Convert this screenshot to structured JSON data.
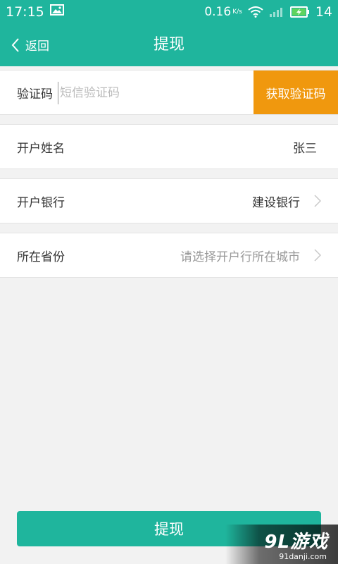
{
  "status_bar": {
    "time": "17:15",
    "net_speed": "0.16",
    "net_speed_unit": "K/s",
    "battery_level": "14",
    "icons": [
      "image-icon",
      "wifi-icon",
      "signal-icon",
      "battery-charging-icon"
    ]
  },
  "header": {
    "back_label": "返回",
    "title": "提现"
  },
  "form": {
    "verification": {
      "label": "验证码",
      "placeholder": "短信验证码",
      "value": "",
      "button_label": "获取验证码"
    },
    "account_name": {
      "label": "开户姓名",
      "value": "张三"
    },
    "bank": {
      "label": "开户银行",
      "value": "建设银行"
    },
    "province": {
      "label": "所在省份",
      "placeholder": "请选择开户行所在城市"
    }
  },
  "submit_label": "提现",
  "watermark": {
    "logo": "9L游戏",
    "url": "91danji.com"
  },
  "colors": {
    "primary": "#1fb59d",
    "accent": "#f0980e",
    "background": "#f2f2f2"
  }
}
